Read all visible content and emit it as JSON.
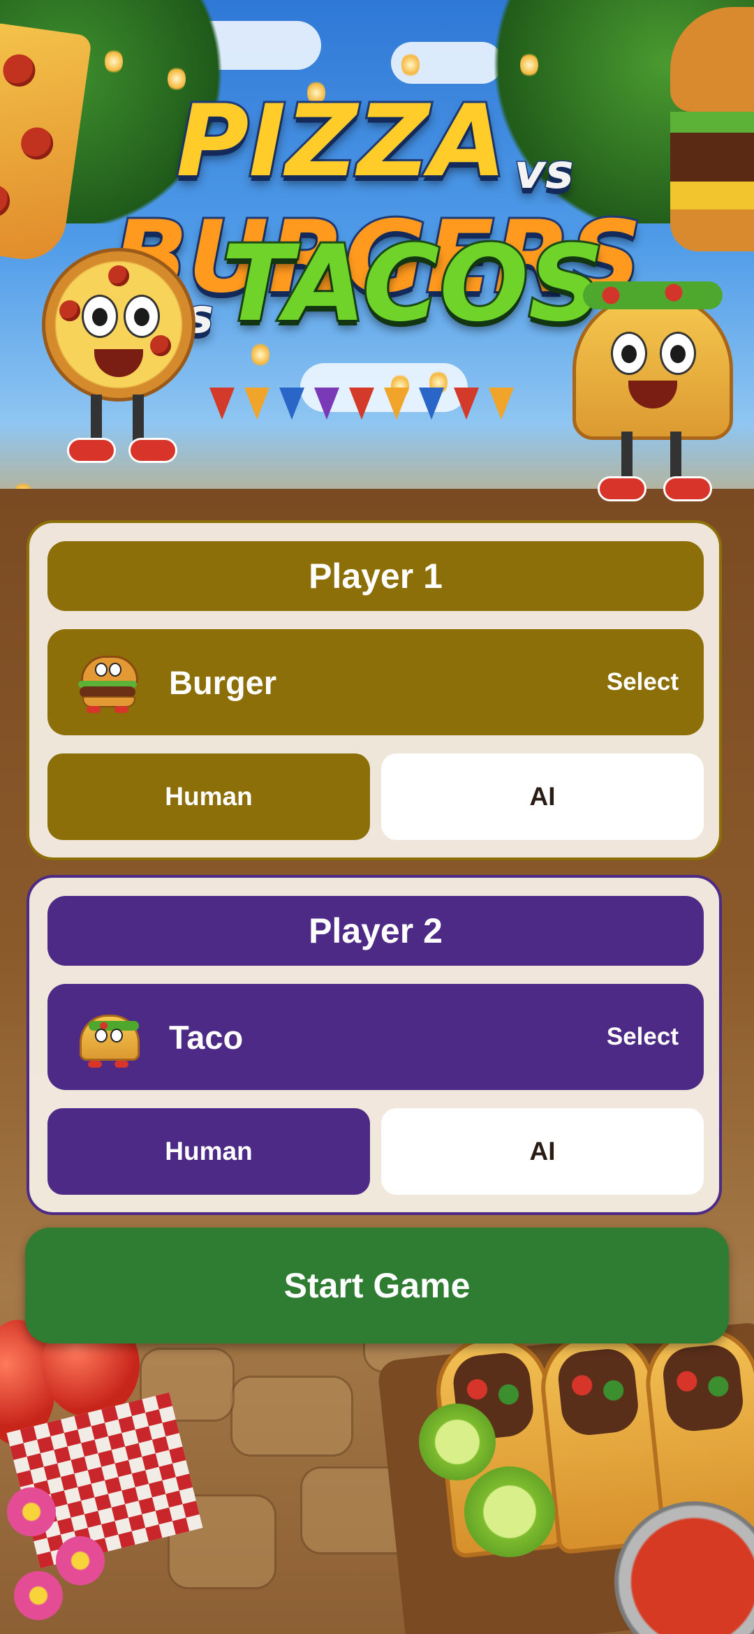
{
  "title": {
    "word_1": "PIZZA",
    "vs_1": "vs",
    "word_2": "BURGERS",
    "vs_2": "vs",
    "word_3": "TACOS"
  },
  "colors": {
    "player_1_accent": "#8c6f09",
    "player_2_accent": "#4d2a86",
    "start_button": "#2e7d32",
    "panel_background": "#f7f1e8"
  },
  "players": [
    {
      "header": "Player 1",
      "character_name": "Burger",
      "character_icon": "burger-mascot-icon",
      "select_label": "Select",
      "mode_options": [
        "Human",
        "AI"
      ],
      "selected_mode": "Human"
    },
    {
      "header": "Player 2",
      "character_name": "Taco",
      "character_icon": "taco-mascot-icon",
      "select_label": "Select",
      "mode_options": [
        "Human",
        "AI"
      ],
      "selected_mode": "Human"
    }
  ],
  "start_button": {
    "label": "Start Game"
  }
}
